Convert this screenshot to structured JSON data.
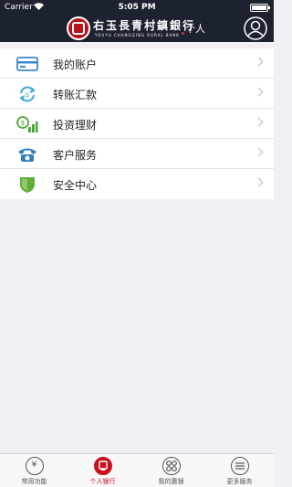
{
  "status_bar": {
    "carrier": "Carrier",
    "time": "5:05 PM",
    "battery_level": 1.0
  },
  "header": {
    "bank_name": "右玉長青村鎮銀行",
    "bank_name_en": "YOUYU CHANGQING RURAL BANK",
    "section": "个人",
    "profile_icon": "user-circle-icon"
  },
  "menu": {
    "items": [
      {
        "label": "我的账户",
        "icon": "account-card-icon",
        "color": "#3f88c9"
      },
      {
        "label": "转账汇款",
        "icon": "transfer-icon",
        "color": "#3fa6d6"
      },
      {
        "label": "投资理财",
        "icon": "investment-icon",
        "color": "#4da536"
      },
      {
        "label": "客户服务",
        "icon": "telephone-icon",
        "color": "#2f7fc0"
      },
      {
        "label": "安全中心",
        "icon": "shield-icon",
        "color": "#5fae3a"
      }
    ]
  },
  "tab_bar": {
    "tabs": [
      {
        "label": "常用功能",
        "icon": "yen-icon",
        "glyph": "¥",
        "active": false
      },
      {
        "label": "个人银行",
        "icon": "personal-bank-icon",
        "glyph": "",
        "active": true
      },
      {
        "label": "我的惠银",
        "icon": "grid-icon",
        "glyph": "",
        "active": false
      },
      {
        "label": "更多服务",
        "icon": "menu-lines-icon",
        "glyph": "",
        "active": false
      }
    ]
  },
  "colors": {
    "header_bg": "#1d2230",
    "brand_red": "#c9111f",
    "page_bg": "#efeff4"
  }
}
